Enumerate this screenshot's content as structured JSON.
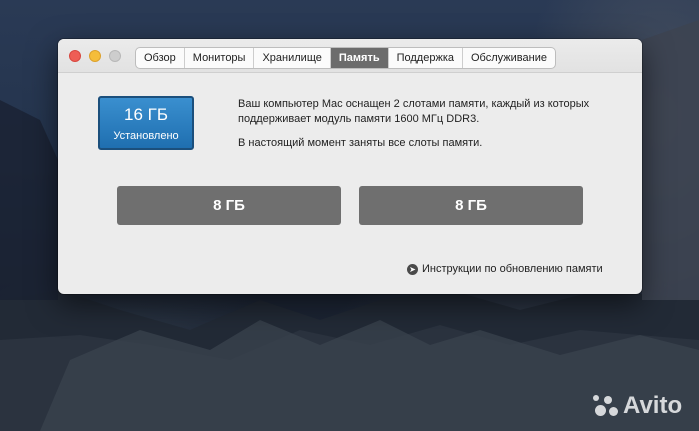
{
  "window": {
    "tabs": [
      {
        "label": "Обзор",
        "active": false
      },
      {
        "label": "Мониторы",
        "active": false
      },
      {
        "label": "Хранилище",
        "active": false
      },
      {
        "label": "Память",
        "active": true
      },
      {
        "label": "Поддержка",
        "active": false
      },
      {
        "label": "Обслуживание",
        "active": false
      }
    ]
  },
  "memory": {
    "total": "16 ГБ",
    "status": "Установлено",
    "description_1": "Ваш компьютер Mac оснащен 2 слотами памяти, каждый из которых поддерживает модуль памяти 1600 МГц DDR3.",
    "description_2": "В настоящий момент заняты все слоты памяти.",
    "slots": [
      "8 ГБ",
      "8 ГБ"
    ],
    "upgrade_link": "Инструкции по обновлению памяти"
  },
  "watermark": "Avito",
  "colors": {
    "accent_badge": "#2a7fc0",
    "slot": "#6f6f6f",
    "active_tab": "#6c6c6c"
  }
}
